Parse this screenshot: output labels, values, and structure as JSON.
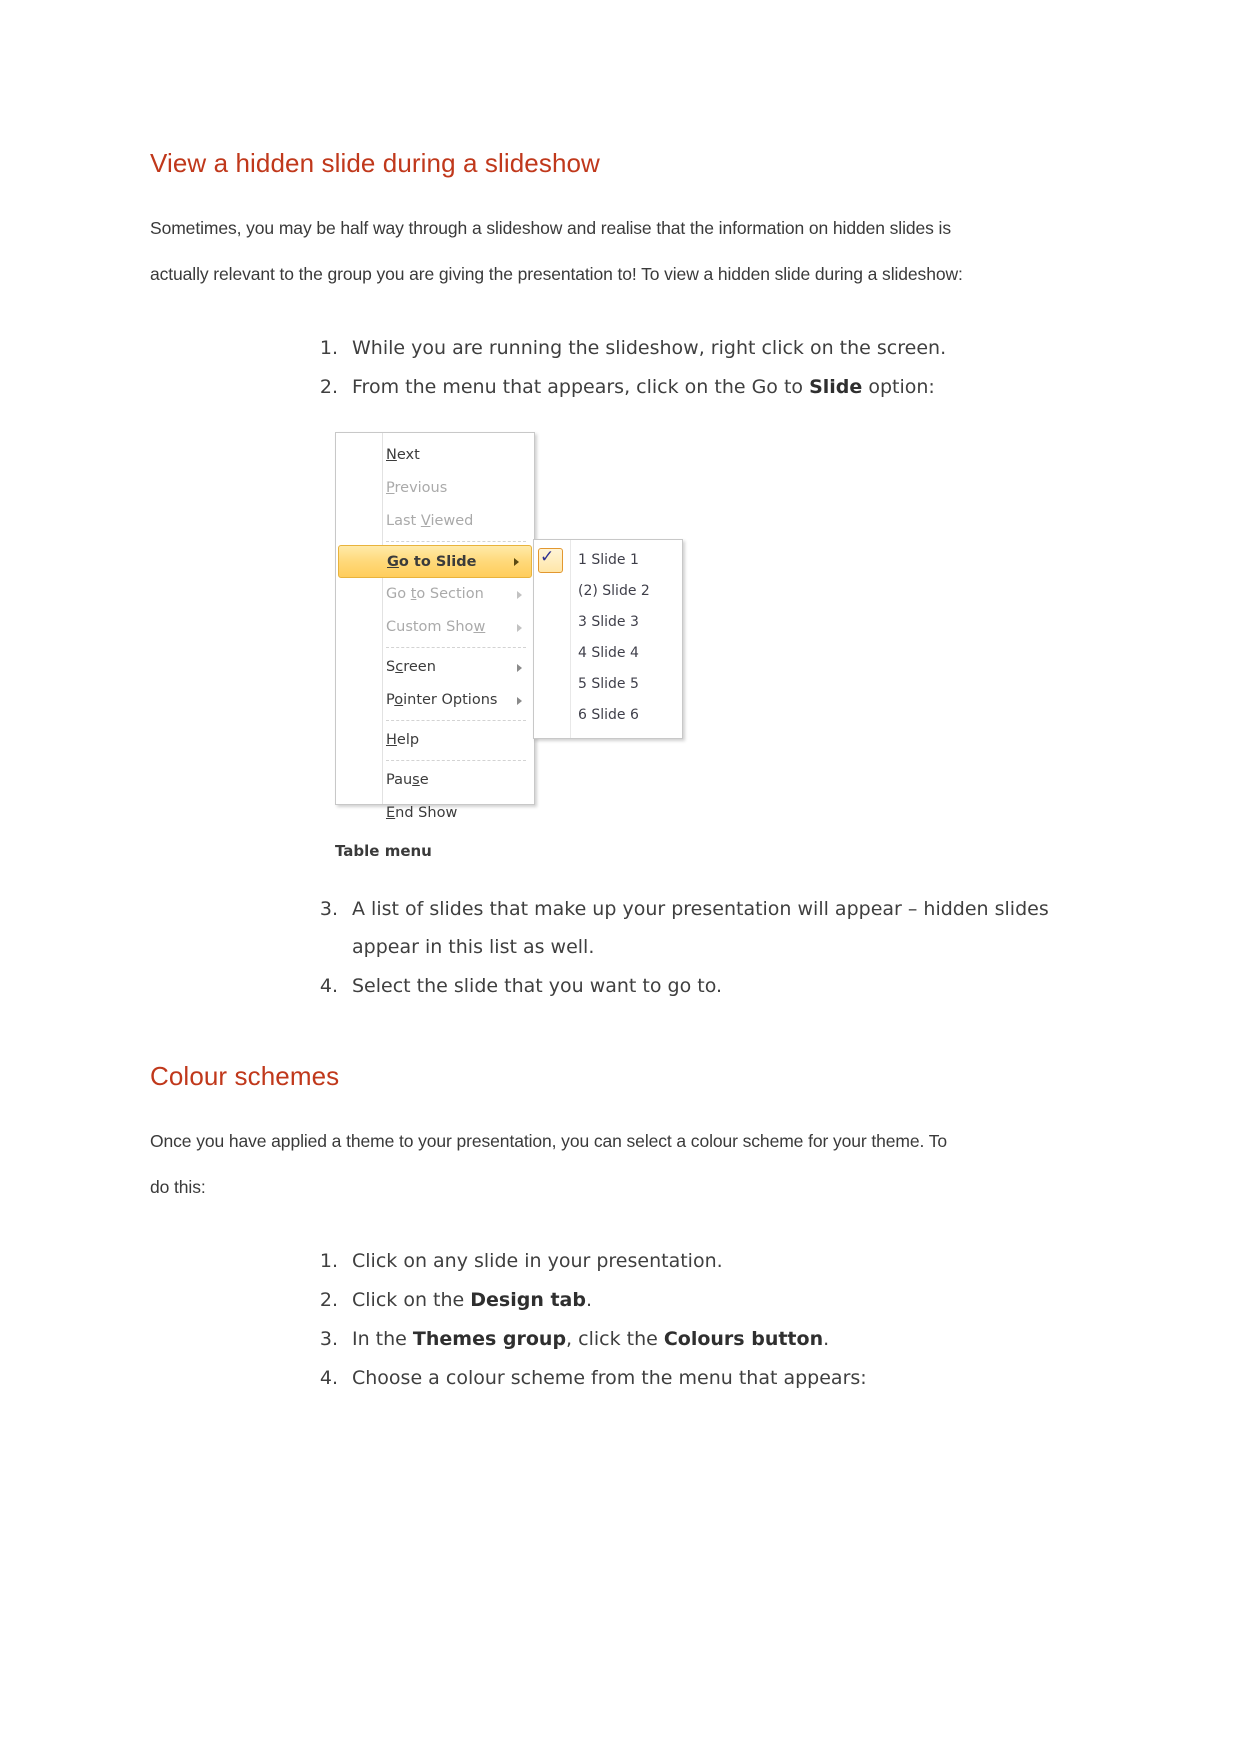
{
  "document": {
    "accent_color": "#c0381b",
    "body_color": "#3a3a3a"
  },
  "section1": {
    "heading": "View a hidden slide during a slideshow",
    "intro_line1": "Sometimes, you may be half way through a slideshow and realise that the information on hidden slides is",
    "intro_line2": "actually relevant to the group you are giving the presentation to! To view a hidden slide during a slideshow:",
    "steps_before": [
      {
        "text": "While you are running the slideshow, right click on the screen."
      },
      {
        "pre": "From the menu that appears, click on the Go to ",
        "bold": "Slide",
        "post": " option:"
      }
    ],
    "steps_after": [
      {
        "text": "A list of slides that make up your presentation will appear – hidden slides appear in this list as well."
      },
      {
        "text": "Select the slide that you want to go to."
      }
    ],
    "figure": {
      "caption": "Table menu",
      "context_menu": {
        "items": [
          {
            "label": "Next",
            "accel": "N",
            "state": "normal",
            "submenu": false
          },
          {
            "label": "Previous",
            "accel": "P",
            "state": "disabled",
            "submenu": false
          },
          {
            "label": "Last Viewed",
            "accel": "V",
            "state": "disabled",
            "submenu": false
          },
          {
            "separator": true
          },
          {
            "label": "Go to Slide",
            "accel": "G",
            "state": "highlight",
            "submenu": true
          },
          {
            "label": "Go to Section",
            "accel": "t",
            "state": "disabled",
            "submenu": true
          },
          {
            "label": "Custom Show",
            "accel": "w",
            "state": "disabled",
            "submenu": true
          },
          {
            "separator": true
          },
          {
            "label": "Screen",
            "accel": "c",
            "state": "normal",
            "submenu": true
          },
          {
            "label": "Pointer Options",
            "accel": "o",
            "state": "normal",
            "submenu": true
          },
          {
            "separator": true
          },
          {
            "label": "Help",
            "accel": "H",
            "state": "normal",
            "submenu": false
          },
          {
            "separator": true
          },
          {
            "label": "Pause",
            "accel": "s",
            "state": "normal",
            "submenu": false
          },
          {
            "label": "End Show",
            "accel": "E",
            "state": "normal",
            "submenu": false
          }
        ]
      },
      "submenu": {
        "items": [
          {
            "label": "1 Slide 1",
            "checked": true
          },
          {
            "label": "(2) Slide 2",
            "checked": false
          },
          {
            "label": "3 Slide 3",
            "checked": false
          },
          {
            "label": "4 Slide 4",
            "checked": false
          },
          {
            "label": "5 Slide 5",
            "checked": false
          },
          {
            "label": "6 Slide 6",
            "checked": false
          }
        ],
        "check_glyph": "✓"
      }
    }
  },
  "section2": {
    "heading": "Colour schemes",
    "intro_line1": "Once you have applied a theme to your presentation, you can select a colour scheme for your theme. To",
    "intro_line2": "do this:",
    "steps": [
      {
        "text": "Click on any slide in your presentation."
      },
      {
        "pre": "Click on the ",
        "bold": "Design tab",
        "post": "."
      },
      {
        "pre": "In the ",
        "bold": "Themes group",
        "mid": ", click the ",
        "bold2": "Colours button",
        "post": "."
      },
      {
        "text": "Choose a colour scheme from the menu that appears:"
      }
    ]
  }
}
